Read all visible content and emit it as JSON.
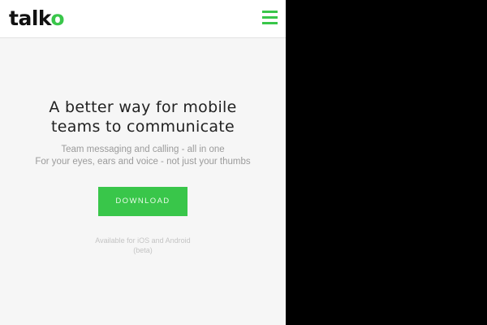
{
  "header": {
    "logo_main": "talk",
    "logo_accent": "o",
    "menu_icon": "hamburger-menu-icon"
  },
  "hero": {
    "headline_line1": "A better way for mobile",
    "headline_line2": "teams to communicate",
    "subtext_line1": "Team messaging and calling - all in one",
    "subtext_line2": "For your eyes, ears and voice - not just your thumbs",
    "download_label": "DOWNLOAD",
    "availability_line1": "Available for iOS and Android",
    "availability_line2": "(beta)"
  },
  "colors": {
    "brand_green": "#39c64a",
    "background": "#f6f6f6",
    "header_bg": "#ffffff",
    "outside": "#000000"
  }
}
